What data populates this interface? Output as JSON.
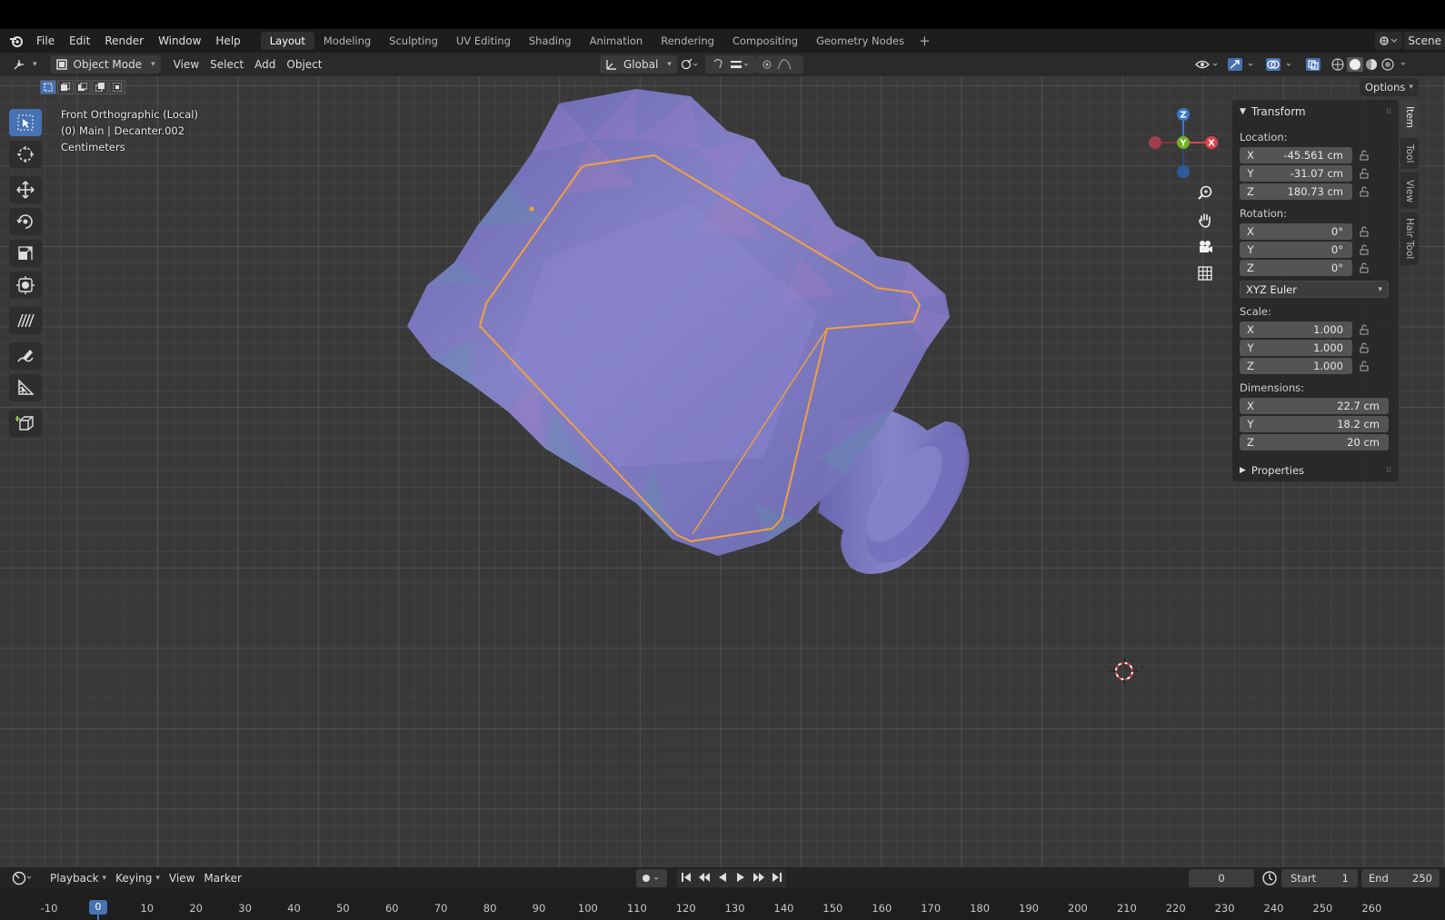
{
  "topbar": {
    "menus": [
      "File",
      "Edit",
      "Render",
      "Window",
      "Help"
    ],
    "workspaces": [
      "Layout",
      "Modeling",
      "Sculpting",
      "UV Editing",
      "Shading",
      "Animation",
      "Rendering",
      "Compositing",
      "Geometry Nodes"
    ],
    "active_workspace": "Layout",
    "scene_label": "Scene"
  },
  "header": {
    "mode": "Object Mode",
    "menus": [
      "View",
      "Select",
      "Add",
      "Object"
    ],
    "transform_orientation": "Global",
    "options_label": "Options"
  },
  "viewport": {
    "view_name": "Front Orthographic (Local)",
    "collection_object": "(0) Main | Decanter.002",
    "units": "Centimeters",
    "gizmo": {
      "z": "Z",
      "y": "Y",
      "x": "X"
    }
  },
  "npanel": {
    "section": "Transform",
    "location_label": "Location:",
    "location": [
      {
        "axis": "X",
        "value": "-45.561 cm"
      },
      {
        "axis": "Y",
        "value": "-31.07 cm"
      },
      {
        "axis": "Z",
        "value": "180.73 cm"
      }
    ],
    "rotation_label": "Rotation:",
    "rotation": [
      {
        "axis": "X",
        "value": "0°"
      },
      {
        "axis": "Y",
        "value": "0°"
      },
      {
        "axis": "Z",
        "value": "0°"
      }
    ],
    "rotation_mode": "XYZ Euler",
    "scale_label": "Scale:",
    "scale": [
      {
        "axis": "X",
        "value": "1.000"
      },
      {
        "axis": "Y",
        "value": "1.000"
      },
      {
        "axis": "Z",
        "value": "1.000"
      }
    ],
    "dimensions_label": "Dimensions:",
    "dimensions": [
      {
        "axis": "X",
        "value": "22.7 cm"
      },
      {
        "axis": "Y",
        "value": "18.2 cm"
      },
      {
        "axis": "Z",
        "value": "20 cm"
      }
    ],
    "properties_label": "Properties",
    "tabs": [
      "Item",
      "Tool",
      "View",
      "Hair Tool"
    ],
    "active_tab": "Item"
  },
  "timeline": {
    "menus": [
      "Playback",
      "Keying",
      "View",
      "Marker"
    ],
    "current_frame": "0",
    "start_label": "Start",
    "start": "1",
    "end_label": "End",
    "end": "250",
    "ruler_labels": [
      "-10",
      "0",
      "10",
      "20",
      "30",
      "40",
      "50",
      "60",
      "70",
      "80",
      "90",
      "100",
      "110",
      "120",
      "130",
      "140",
      "150",
      "160",
      "170",
      "180",
      "190",
      "200",
      "210",
      "220",
      "230",
      "240",
      "250",
      "260"
    ],
    "playhead": "0"
  },
  "colors": {
    "accent": "#4772b3",
    "selection_outline": "#f0a040",
    "mesh": "#7a7ac8",
    "axis_x": "#e0404a",
    "axis_y": "#70b020",
    "axis_z": "#3a78d0"
  }
}
